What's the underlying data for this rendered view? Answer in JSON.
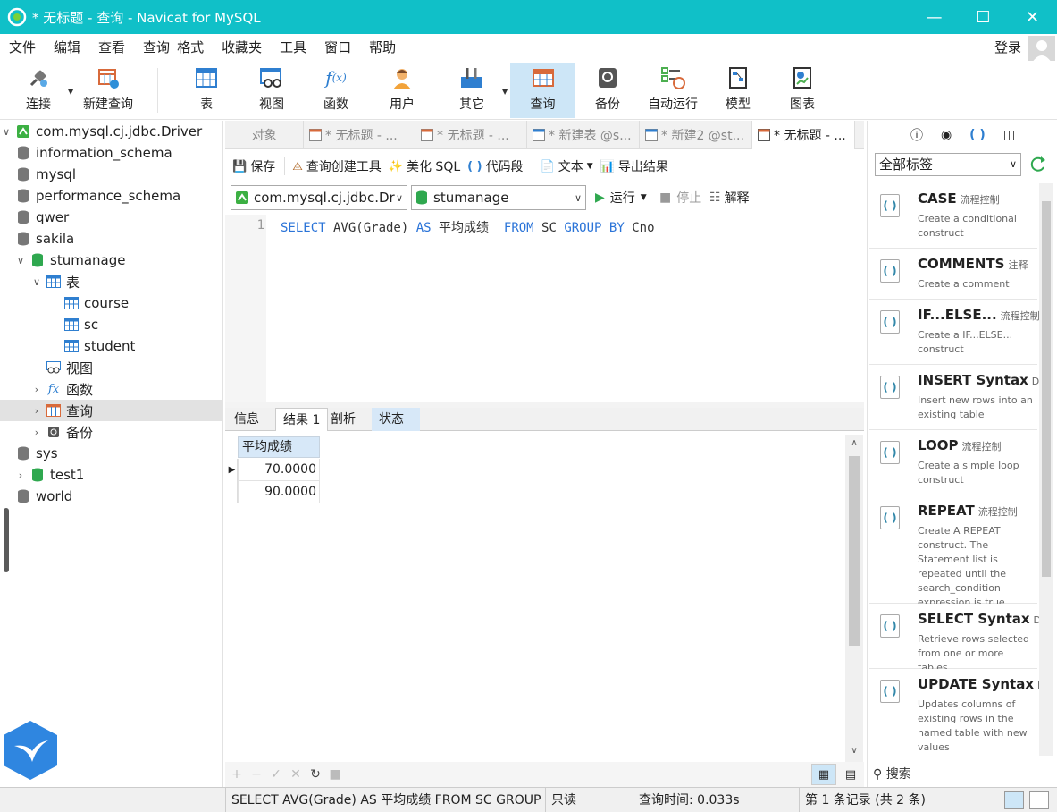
{
  "window": {
    "title": "* 无标题 - 查询 - Navicat for MySQL"
  },
  "menu": [
    "文件",
    "编辑",
    "查看",
    "查询",
    "格式",
    "收藏夹",
    "工具",
    "窗口",
    "帮助"
  ],
  "login_label": "登录",
  "toolbar": [
    {
      "label": "连接",
      "icon": "plug-icon"
    },
    {
      "label": "新建查询",
      "icon": "new-query-icon"
    },
    {
      "label": "表",
      "icon": "table-icon"
    },
    {
      "label": "视图",
      "icon": "view-icon"
    },
    {
      "label": "函数",
      "icon": "function-icon"
    },
    {
      "label": "用户",
      "icon": "user-icon"
    },
    {
      "label": "其它",
      "icon": "tools-icon"
    },
    {
      "label": "查询",
      "icon": "query-icon"
    },
    {
      "label": "备份",
      "icon": "backup-icon"
    },
    {
      "label": "自动运行",
      "icon": "schedule-icon"
    },
    {
      "label": "模型",
      "icon": "model-icon"
    },
    {
      "label": "图表",
      "icon": "chart-icon"
    }
  ],
  "tree": {
    "connection": "com.mysql.cj.jdbc.Driver",
    "databases": [
      "information_schema",
      "mysql",
      "performance_schema",
      "qwer",
      "sakila",
      "stumanage"
    ],
    "tables_label": "表",
    "tables": [
      "course",
      "sc",
      "student"
    ],
    "view_label": "视图",
    "function_label": "函数",
    "query_label": "查询",
    "backup_label": "备份",
    "other_dbs": [
      "sys",
      "test1",
      "world"
    ]
  },
  "tabs": [
    "对象",
    "* 无标题 - ...",
    "* 无标题 - ...",
    "* 新建表 @s...",
    "* 新建2 @st...",
    "* 无标题 - ..."
  ],
  "editor_toolbar": {
    "save": "保存",
    "builder": "查询创建工具",
    "beautify": "美化 SQL",
    "snippet": "代码段",
    "text": "文本",
    "export": "导出结果"
  },
  "connection_combo": "com.mysql.cj.jdbc.Dr",
  "database_combo": "stumanage",
  "run_label": "运行",
  "stop_label": "停止",
  "explain_label": "解释",
  "editor": {
    "line_no": "1",
    "kw_select": "SELECT",
    "part_avg": " AVG(Grade) ",
    "kw_as": "AS",
    "part_alias": " 平均成绩  ",
    "kw_from": "FROM",
    "part_table": " SC ",
    "kw_group": "GROUP",
    "kw_by": "BY",
    "part_col": " Cno"
  },
  "result_tabs": [
    "信息",
    "结果 1",
    "剖析",
    "状态"
  ],
  "grid": {
    "header": "平均成绩",
    "rows": [
      "70.0000",
      "90.0000"
    ]
  },
  "right_panel": {
    "filter": "全部标签",
    "search": "搜索",
    "snippets": [
      {
        "name": "CASE",
        "cat": "流程控制",
        "desc": "Create a conditional construct"
      },
      {
        "name": "COMMENTS",
        "cat": "注释",
        "desc": "Create a comment"
      },
      {
        "name": "IF...ELSE...",
        "cat": "流程控制",
        "desc": "Create a IF...ELSE... construct"
      },
      {
        "name": "INSERT Syntax",
        "cat": "DM",
        "desc": "Insert new rows into an existing table"
      },
      {
        "name": "LOOP",
        "cat": "流程控制",
        "desc": "Create a simple loop construct"
      },
      {
        "name": "REPEAT",
        "cat": "流程控制",
        "desc": "Create A REPEAT construct. The Statement list is repeated until the search_condition expression is true."
      },
      {
        "name": "SELECT Syntax",
        "cat": "DM",
        "desc": "Retrieve rows selected from one or more tables"
      },
      {
        "name": "UPDATE Syntax",
        "cat": "DM",
        "desc": "Updates columns of existing rows in the named table with new values"
      }
    ]
  },
  "status": {
    "sql": "SELECT AVG(Grade) AS 平均成绩  FROM SC GROUP BY Cno",
    "readonly": "只读",
    "time": "查询时间: 0.033s",
    "record": "第 1 条记录  (共 2 条)"
  },
  "colors": {
    "titlebar": "#10c0c8",
    "keyword": "#2b74d8",
    "selection": "#cde6f7"
  }
}
